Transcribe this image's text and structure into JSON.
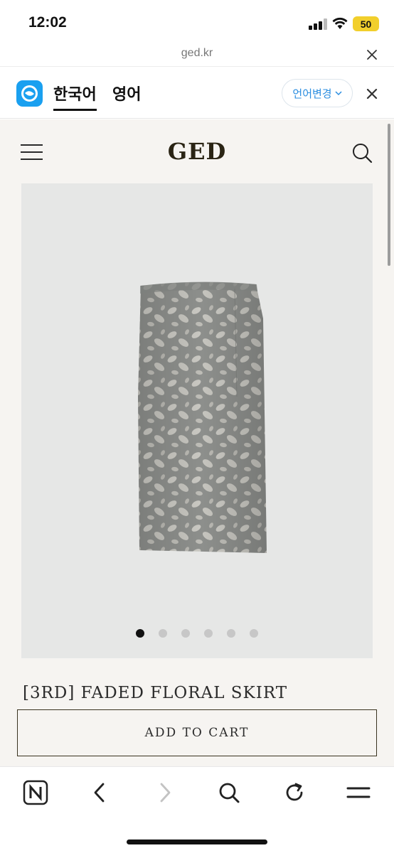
{
  "status_bar": {
    "time": "12:02",
    "battery": "50",
    "battery_color": "#f2cf2c"
  },
  "browser": {
    "url": "ged.kr"
  },
  "translate_bar": {
    "tab_korean": "한국어",
    "tab_english": "영어",
    "change_language": "언어변경"
  },
  "site": {
    "logo": "GED",
    "product_title": "[3RD] FADED FLORAL SKIRT",
    "add_to_cart": "ADD TO CART",
    "image_dots": {
      "count": 6,
      "active_index": 0
    }
  },
  "toolbar": {
    "icons": [
      "naver-home-icon",
      "back-icon",
      "forward-icon",
      "search-icon",
      "reload-icon",
      "menu-icon"
    ]
  }
}
